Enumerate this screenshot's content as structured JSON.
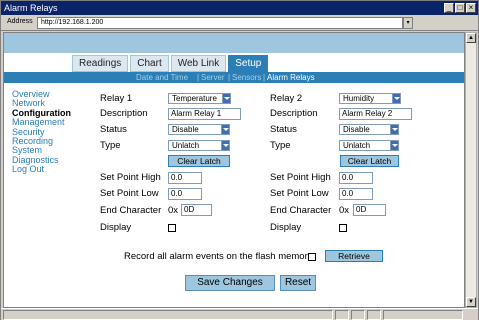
{
  "window": {
    "title": "Alarm Relays"
  },
  "address": {
    "label": "Address",
    "url": "http://192.168.1.200"
  },
  "tabs": [
    {
      "label": "Readings"
    },
    {
      "label": "Chart"
    },
    {
      "label": "Web Link"
    },
    {
      "label": "Setup",
      "active": true
    }
  ],
  "subnav": [
    {
      "label": "Date and Time"
    },
    {
      "label": "Server"
    },
    {
      "label": "Sensors"
    },
    {
      "label": "Alarm Relays",
      "active": true
    }
  ],
  "sidebar": [
    {
      "label": "Overview"
    },
    {
      "label": "Network"
    },
    {
      "label": "Configuration",
      "active": true
    },
    {
      "label": "Management"
    },
    {
      "label": "Security"
    },
    {
      "label": "Recording"
    },
    {
      "label": "System"
    },
    {
      "label": "Diagnostics"
    },
    {
      "label": "Log Out"
    }
  ],
  "labels": {
    "relay1": "Relay 1",
    "relay2": "Relay 2",
    "description": "Description",
    "status": "Status",
    "type": "Type",
    "setpoint_high": "Set Point High",
    "setpoint_low": "Set Point Low",
    "end_char": "End Character",
    "display": "Display",
    "hex_prefix": "0x"
  },
  "relay1": {
    "sensor": "Temperature",
    "description": "Alarm Relay 1",
    "status": "Disable",
    "type": "Unlatch",
    "clear_latch": "Clear Latch",
    "setpoint_high": "0.0",
    "setpoint_low": "0.0",
    "end_char": "0D",
    "display_checked": false
  },
  "relay2": {
    "sensor": "Humidity",
    "description": "Alarm Relay 2",
    "status": "Disable",
    "type": "Unlatch",
    "clear_latch": "Clear Latch",
    "setpoint_high": "0.0",
    "setpoint_low": "0.0",
    "end_char": "0D",
    "display_checked": false
  },
  "record": {
    "label": "Record all alarm events on the flash memory",
    "checked": false,
    "retrieve": "Retrieve"
  },
  "actions": {
    "save": "Save Changes",
    "reset": "Reset"
  },
  "colors": {
    "accent": "#2b7fb5",
    "band": "#9ec6de",
    "titlebar": "#0a246a"
  }
}
